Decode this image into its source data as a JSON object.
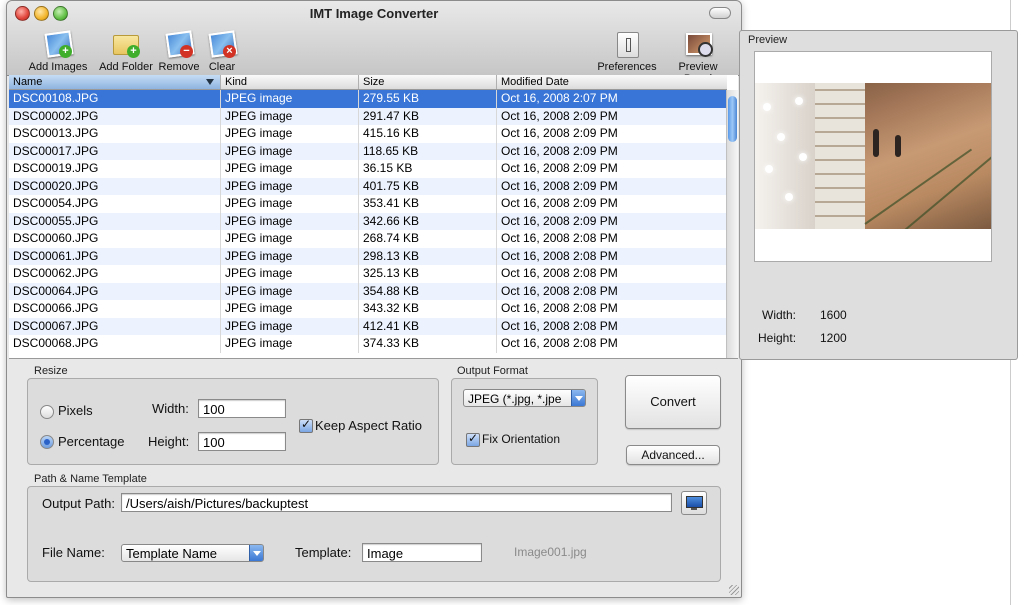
{
  "app": {
    "title": "IMT Image Converter"
  },
  "toolbar": {
    "add_images": "Add Images",
    "add_folder": "Add Folder",
    "remove": "Remove",
    "clear": "Clear",
    "preferences": "Preferences",
    "preview_panel": "Preview Panel"
  },
  "table": {
    "columns": [
      "Name",
      "Kind",
      "Size",
      "Modified Date"
    ],
    "rows": [
      {
        "name": "DSC00108.JPG",
        "kind": "JPEG image",
        "size": "279.55 KB",
        "date": "Oct 16, 2008 2:07 PM"
      },
      {
        "name": "DSC00002.JPG",
        "kind": "JPEG image",
        "size": "291.47 KB",
        "date": "Oct 16, 2008 2:09 PM"
      },
      {
        "name": "DSC00013.JPG",
        "kind": "JPEG image",
        "size": "415.16 KB",
        "date": "Oct 16, 2008 2:09 PM"
      },
      {
        "name": "DSC00017.JPG",
        "kind": "JPEG image",
        "size": "118.65 KB",
        "date": "Oct 16, 2008 2:09 PM"
      },
      {
        "name": "DSC00019.JPG",
        "kind": "JPEG image",
        "size": "36.15 KB",
        "date": "Oct 16, 2008 2:09 PM"
      },
      {
        "name": "DSC00020.JPG",
        "kind": "JPEG image",
        "size": "401.75 KB",
        "date": "Oct 16, 2008 2:09 PM"
      },
      {
        "name": "DSC00054.JPG",
        "kind": "JPEG image",
        "size": "353.41 KB",
        "date": "Oct 16, 2008 2:09 PM"
      },
      {
        "name": "DSC00055.JPG",
        "kind": "JPEG image",
        "size": "342.66 KB",
        "date": "Oct 16, 2008 2:09 PM"
      },
      {
        "name": "DSC00060.JPG",
        "kind": "JPEG image",
        "size": "268.74 KB",
        "date": "Oct 16, 2008 2:08 PM"
      },
      {
        "name": "DSC00061.JPG",
        "kind": "JPEG image",
        "size": "298.13 KB",
        "date": "Oct 16, 2008 2:08 PM"
      },
      {
        "name": "DSC00062.JPG",
        "kind": "JPEG image",
        "size": "325.13 KB",
        "date": "Oct 16, 2008 2:08 PM"
      },
      {
        "name": "DSC00064.JPG",
        "kind": "JPEG image",
        "size": "354.88 KB",
        "date": "Oct 16, 2008 2:08 PM"
      },
      {
        "name": "DSC00066.JPG",
        "kind": "JPEG image",
        "size": "343.32 KB",
        "date": "Oct 16, 2008 2:08 PM"
      },
      {
        "name": "DSC00067.JPG",
        "kind": "JPEG image",
        "size": "412.41 KB",
        "date": "Oct 16, 2008 2:08 PM"
      },
      {
        "name": "DSC00068.JPG",
        "kind": "JPEG image",
        "size": "374.33 KB",
        "date": "Oct 16, 2008 2:08 PM"
      }
    ]
  },
  "resize": {
    "group_label": "Resize",
    "pixels_label": "Pixels",
    "percentage_label": "Percentage",
    "width_label": "Width:",
    "width_value": "100",
    "height_label": "Height:",
    "height_value": "100",
    "keep_aspect_label": "Keep Aspect Ratio"
  },
  "output_format": {
    "group_label": "Output Format",
    "selected": "JPEG (*.jpg, *.jpe",
    "fix_orientation_label": "Fix Orientation"
  },
  "actions": {
    "convert": "Convert",
    "advanced": "Advanced..."
  },
  "template": {
    "group_label": "Path & Name Template",
    "output_path_label": "Output Path:",
    "output_path_value": "/Users/aish/Pictures/backuptest",
    "file_name_label": "File Name:",
    "file_name_selected": "Template Name",
    "template_label": "Template:",
    "template_value": "Image",
    "example": "Image001.jpg"
  },
  "preview": {
    "title": "Preview",
    "width_label": "Width:",
    "width_value": "1600",
    "height_label": "Height:",
    "height_value": "1200"
  }
}
